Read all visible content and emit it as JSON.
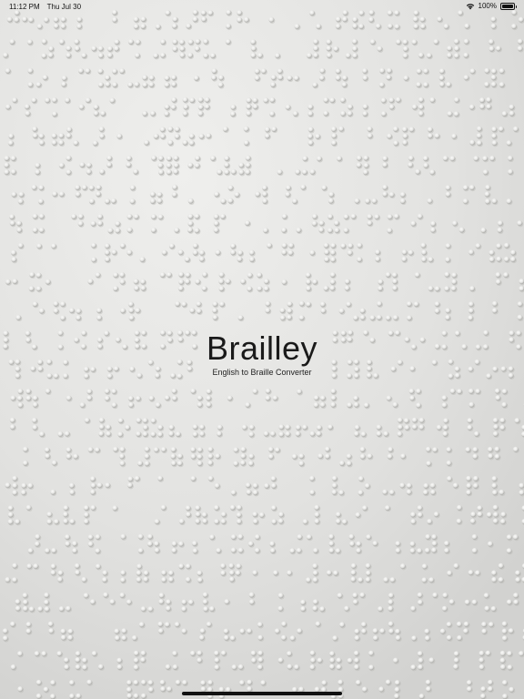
{
  "status_bar": {
    "time": "11:12 PM",
    "date": "Thu Jul 30",
    "battery_text": "100%",
    "battery_level": 1.0,
    "wifi_icon": "wifi-icon",
    "battery_icon": "battery-icon"
  },
  "splash": {
    "title": "Brailley",
    "subtitle": "English to Braille Converter"
  },
  "background": {
    "image": "embossed-braille-paper"
  }
}
